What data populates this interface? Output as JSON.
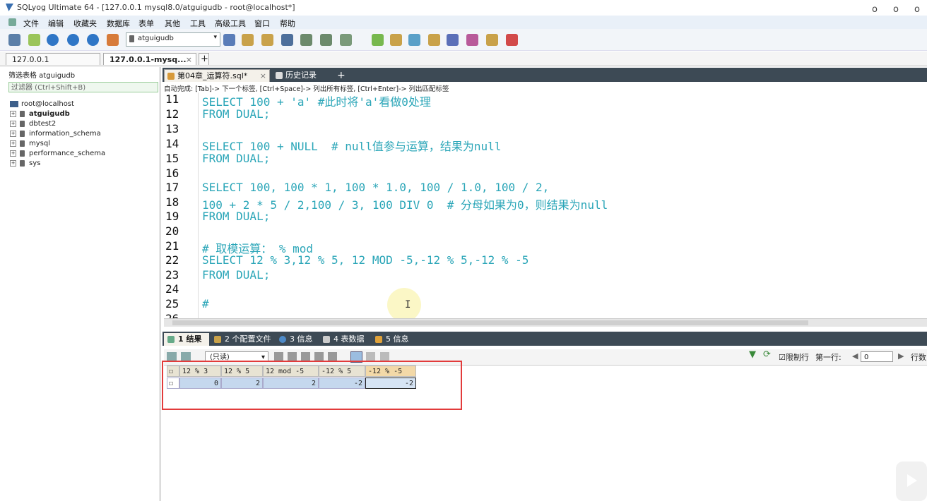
{
  "window": {
    "title": "SQLyog Ultimate 64 - [127.0.0.1 mysql8.0/atguigudb - root@localhost*]",
    "controls": [
      "o",
      "o",
      "o"
    ]
  },
  "menu": [
    "文件",
    "编辑",
    "收藏夹",
    "数据库",
    "表单",
    "其他",
    "工具",
    "高级工具",
    "窗口",
    "帮助"
  ],
  "toolbar": {
    "db_select": "atguigudb"
  },
  "connection_tabs": [
    {
      "label": "127.0.0.1"
    },
    {
      "label": "127.0.0.1-mysq...",
      "close": "×"
    }
  ],
  "add_tab": "+",
  "left_pane": {
    "title": "筛选表格 atguigudb",
    "filter_placeholder": "过滤器 (Ctrl+Shift+B)",
    "root": "root@localhost",
    "databases": [
      "atguigudb",
      "dbtest2",
      "information_schema",
      "mysql",
      "performance_schema",
      "sys"
    ],
    "expand_symbol": "+"
  },
  "editor_tabs": [
    {
      "label": "第04章_运算符.sql*",
      "close": "×"
    },
    {
      "label": "历史记录"
    }
  ],
  "autocomplete_hint": "自动完成: [Tab]-> 下一个标签, [Ctrl+Space]-> 列出所有标签, [Ctrl+Enter]-> 列出匹配标签",
  "code_lines": [
    {
      "n": "11",
      "text": "SELECT 100 + 'a' #此时将'a'看做0处理"
    },
    {
      "n": "12",
      "text": "FROM DUAL;"
    },
    {
      "n": "13",
      "text": ""
    },
    {
      "n": "14",
      "text": "SELECT 100 + NULL  # null值参与运算，结果为null"
    },
    {
      "n": "15",
      "text": "FROM DUAL;"
    },
    {
      "n": "16",
      "text": ""
    },
    {
      "n": "17",
      "text": "SELECT 100, 100 * 1, 100 * 1.0, 100 / 1.0, 100 / 2,"
    },
    {
      "n": "18",
      "text": "100 + 2 * 5 / 2,100 / 3, 100 DIV 0  # 分母如果为0，则结果为null"
    },
    {
      "n": "19",
      "text": "FROM DUAL;"
    },
    {
      "n": "20",
      "text": ""
    },
    {
      "n": "21",
      "text": "# 取模运算： % mod"
    },
    {
      "n": "22",
      "text": "SELECT 12 % 3,12 % 5, 12 MOD -5,-12 % 5,-12 % -5"
    },
    {
      "n": "23",
      "text": "FROM DUAL;"
    },
    {
      "n": "24",
      "text": ""
    },
    {
      "n": "25",
      "text": "#"
    },
    {
      "n": "26",
      "text": ""
    }
  ],
  "result_tabs": [
    {
      "label": "1 结果"
    },
    {
      "label": "2 个配置文件"
    },
    {
      "label": "3 信息"
    },
    {
      "label": "4 表数据"
    },
    {
      "label": "5 信息"
    }
  ],
  "result_toolbar": {
    "readonly_label": "(只读)",
    "limit_label": "限制行",
    "first_row_label": "第一行:",
    "first_row_value": "0",
    "rows_label": "行数"
  },
  "result_grid": {
    "columns": [
      "12 % 3",
      "12 % 5",
      "12 mod -5",
      "-12 % 5",
      "-12 % -5"
    ],
    "rows": [
      [
        "0",
        "2",
        "2",
        "-2",
        "-2"
      ]
    ]
  },
  "colors": {
    "highlight_box": "#e23b3b",
    "tab_bar": "#3d4a55",
    "code": "#2ba6b8"
  }
}
